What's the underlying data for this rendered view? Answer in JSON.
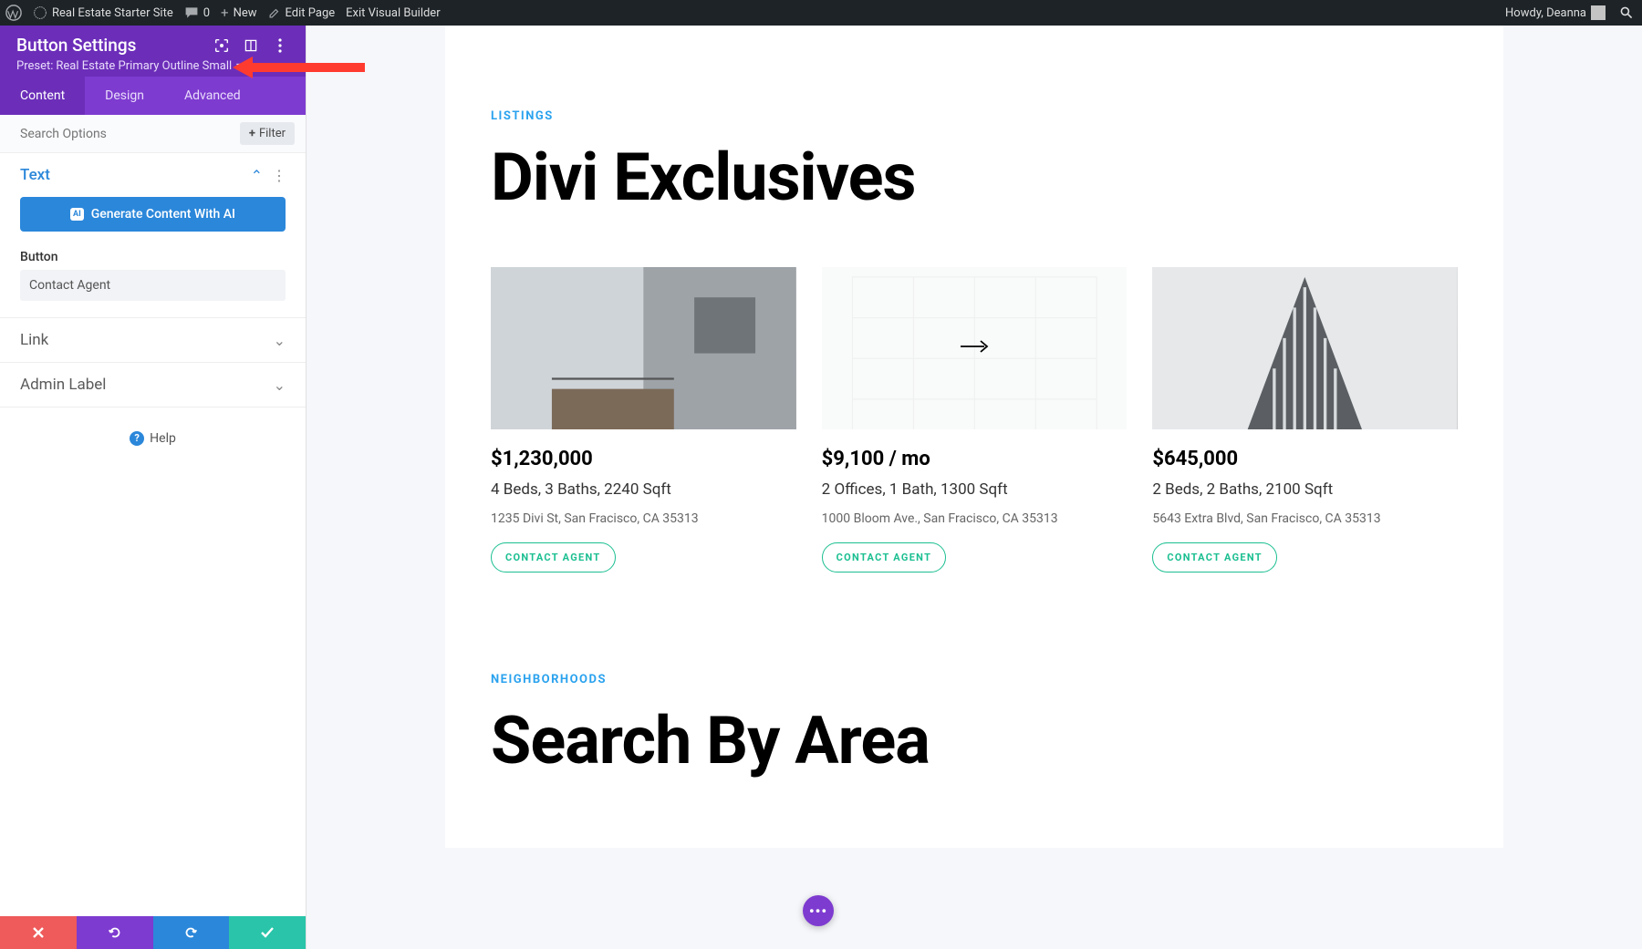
{
  "adminbar": {
    "site_name": "Real Estate Starter Site",
    "comments": "0",
    "new": "New",
    "edit_page": "Edit Page",
    "exit_builder": "Exit Visual Builder",
    "howdy": "Howdy, Deanna"
  },
  "panel": {
    "title": "Button Settings",
    "preset_prefix": "Preset: ",
    "preset_name": "Real Estate Primary Outline Small",
    "tabs": {
      "content": "Content",
      "design": "Design",
      "advanced": "Advanced"
    },
    "search_placeholder": "Search Options",
    "filter": "Filter",
    "sections": {
      "text": "Text",
      "link": "Link",
      "admin_label": "Admin Label"
    },
    "generate_ai": "Generate Content With AI",
    "button_label": "Button",
    "button_value": "Contact Agent",
    "help": "Help"
  },
  "page": {
    "eyebrow1": "LISTINGS",
    "heading1": "Divi Exclusives",
    "eyebrow2": "NEIGHBORHOODS",
    "heading2": "Search By Area",
    "listings": [
      {
        "price": "$1,230,000",
        "specs": "4 Beds, 3 Baths, 2240 Sqft",
        "addr": "1235 Divi St, San Fracisco, CA 35313",
        "cta": "CONTACT AGENT"
      },
      {
        "price": "$9,100 / mo",
        "specs": "2 Offices, 1 Bath, 1300 Sqft",
        "addr": "1000 Bloom Ave., San Fracisco, CA 35313",
        "cta": "CONTACT AGENT"
      },
      {
        "price": "$645,000",
        "specs": "2 Beds, 2 Baths, 2100 Sqft",
        "addr": "5643 Extra Blvd, San Fracisco, CA 35313",
        "cta": "CONTACT AGENT"
      }
    ]
  },
  "fab": "…"
}
